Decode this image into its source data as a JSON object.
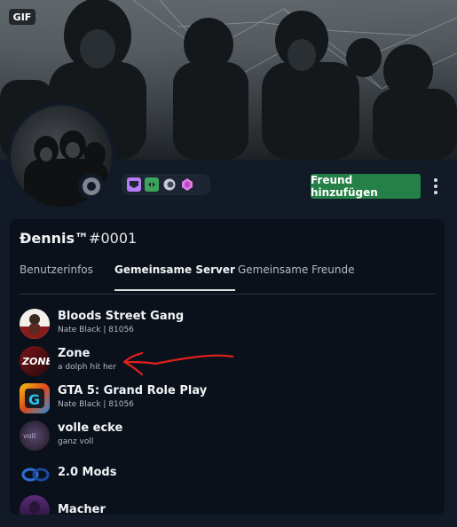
{
  "profile": {
    "gif_badge": "GIF",
    "username": "Đennis™",
    "discriminator": "#0001",
    "add_friend_label": "Freund hinzufügen",
    "badges": [
      "nitro-icon",
      "hypesquad-icon",
      "boost-icon",
      "boost-gem-icon"
    ]
  },
  "tabs": [
    {
      "label": "Benutzerinfos"
    },
    {
      "label": "Gemeinsame Server"
    },
    {
      "label": "Gemeinsame Freunde"
    }
  ],
  "servers": [
    {
      "name": "Bloods Street Gang",
      "nickname": "Nate Black | 81056",
      "icon": "bloods-server-icon"
    },
    {
      "name": "Zone",
      "nickname": "a dolph hit her",
      "icon": "zone-server-icon"
    },
    {
      "name": "GTA 5: Grand Role Play",
      "nickname": "Nate Black | 81056",
      "icon": "gta-server-icon"
    },
    {
      "name": "volle ecke",
      "nickname": "ganz voll",
      "icon": "volle-ecke-server-icon"
    },
    {
      "name": "2.0 Mods",
      "nickname": "",
      "icon": "mods-server-icon"
    },
    {
      "name": "Macher",
      "nickname": "",
      "icon": "macher-server-icon"
    }
  ],
  "colors": {
    "accent_green": "#248046",
    "background": "#111a26",
    "card": "#0b111b",
    "annotation_red": "#e0201c"
  }
}
